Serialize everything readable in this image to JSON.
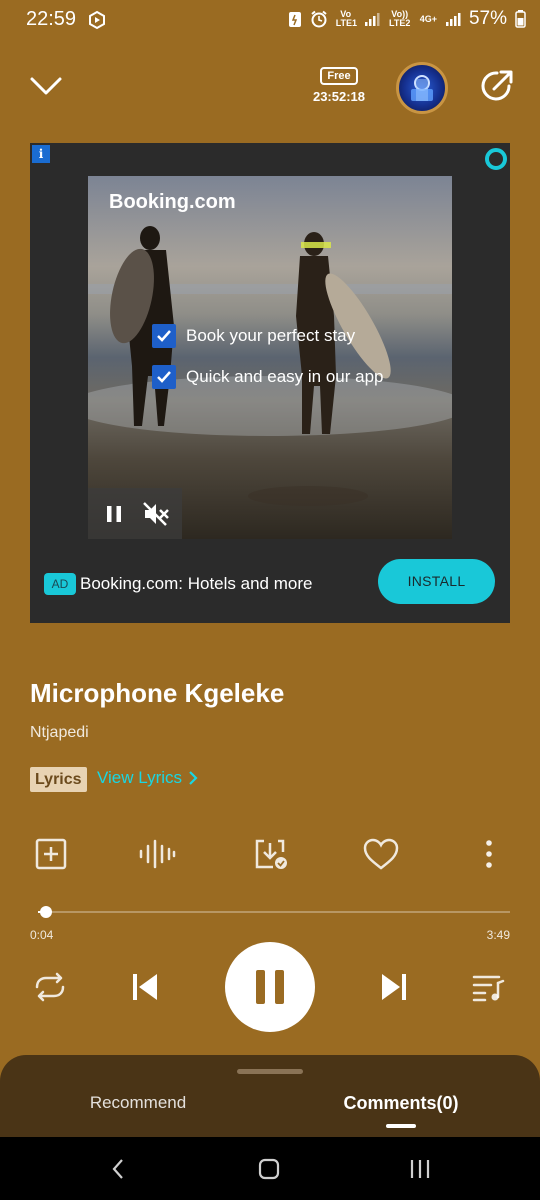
{
  "status_bar": {
    "time": "22:59",
    "sim1": "Vo LTE1",
    "sim2": "Vo)) LTE2",
    "net": "4G+",
    "battery": "57%"
  },
  "header": {
    "free_label": "Free",
    "free_timer": "23:52:18",
    "down_icon": "chevron-down-icon",
    "share_icon": "share-icon"
  },
  "ad": {
    "brand": "Booking.com",
    "bullets": [
      "Book your perfect stay",
      "Quick and easy in our app"
    ],
    "info_label": "i",
    "tag": "AD",
    "title": "Booking.com: Hotels and more",
    "install_label": "INSTALL"
  },
  "song": {
    "title": "Microphone Kgeleke",
    "artist": "Ntjapedi",
    "lyrics_badge": "Lyrics",
    "view_lyrics": "View Lyrics"
  },
  "progress": {
    "current": "0:04",
    "total": "3:49",
    "fraction": 0.017
  },
  "tabs": {
    "recommend": "Recommend",
    "comments": "Comments(0)"
  },
  "colors": {
    "background": "#9a6b22",
    "accent": "#19d6e3",
    "panel": "#4a3416"
  }
}
